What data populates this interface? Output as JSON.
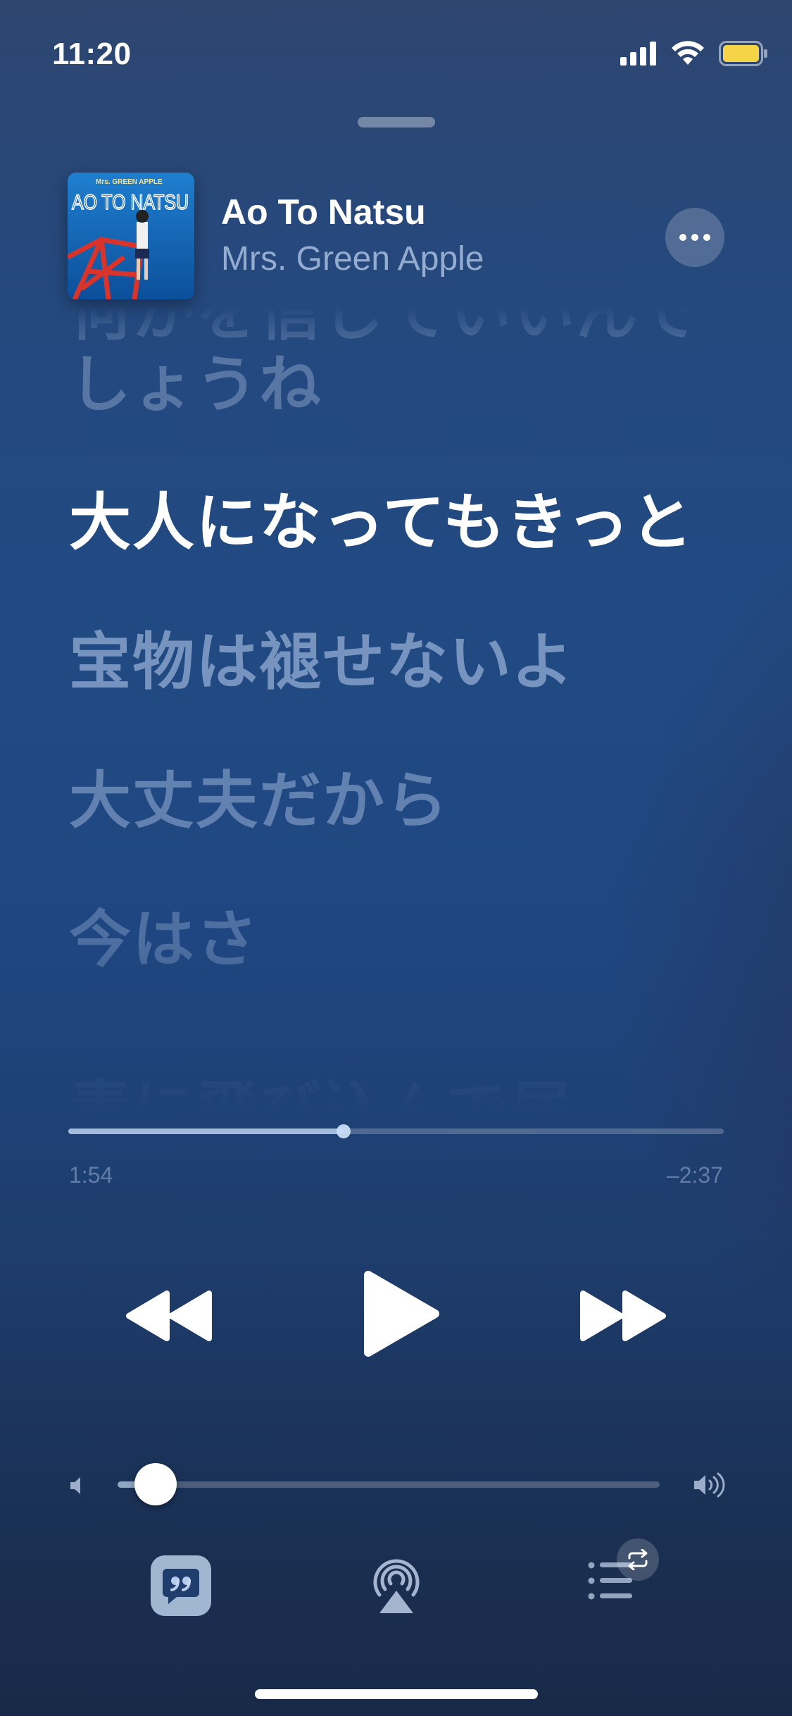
{
  "status_bar": {
    "time": "11:20",
    "icons": [
      "cellular-signal-icon",
      "wifi-icon",
      "battery-icon"
    ],
    "battery_color": "#f5d547"
  },
  "now_playing": {
    "title": "Ao To Natsu",
    "artist": "Mrs. Green Apple",
    "album_art": {
      "band_text": "Mrs. GREEN APPLE",
      "title_text": "AO TO NATSU"
    }
  },
  "lyrics": {
    "lines": [
      "何かを信じていいんで",
      "しょうね",
      "大人になってもきっと",
      "宝物は褪せないよ",
      "大丈夫だから",
      "今はさ",
      "青に飛び込んで居"
    ],
    "current_index": 2
  },
  "playback": {
    "elapsed": "1:54",
    "remaining": "–2:37",
    "progress": 0.42
  },
  "controls": {
    "rewind_icon": "rewind-icon",
    "play_icon": "play-icon",
    "forward_icon": "fast-forward-icon"
  },
  "volume": {
    "level": 0.07,
    "low_icon": "speaker-low-icon",
    "high_icon": "speaker-high-icon"
  },
  "toolbar": {
    "lyrics_icon": "lyrics-quote-icon",
    "airplay_icon": "airplay-icon",
    "queue_icon": "queue-list-icon",
    "repeat_icon": "repeat-icon"
  },
  "colors": {
    "background_top": "#2e4670",
    "background_mid": "#214a83",
    "background_bottom": "#192a48",
    "accent": "#c8dcf5"
  }
}
